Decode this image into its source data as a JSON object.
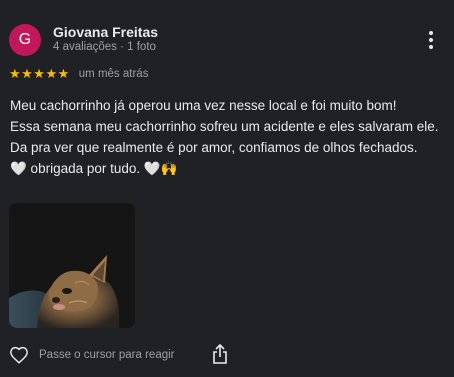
{
  "reviewer": {
    "initial": "G",
    "name": "Giovana Freitas",
    "meta": "4 avaliações · 1 foto",
    "avatar_color": "#c2185b"
  },
  "rating": {
    "stars": "★★★★★",
    "value": 5,
    "max": 5,
    "time": "um mês atrás",
    "star_color": "#fbbc04"
  },
  "review": {
    "line1": "Meu cachorrinho já operou uma vez nesse local e foi muito bom!",
    "line2": "Essa semana meu cachorrinho sofreu um acidente e eles salvaram ele.",
    "line3": "Da pra ver que realmente é por amor, confiamos de olhos fechados.",
    "line4": "🤍 obrigada por tudo. 🤍🙌"
  },
  "actions": {
    "like_label": "Passe o cursor para reagir",
    "like_icon": "heart-outline-icon",
    "share_icon": "share-icon",
    "more_icon": "more-vert-icon"
  },
  "colors": {
    "background": "#202124",
    "text": "#e8eaed",
    "secondary_text": "#9aa0a6"
  }
}
